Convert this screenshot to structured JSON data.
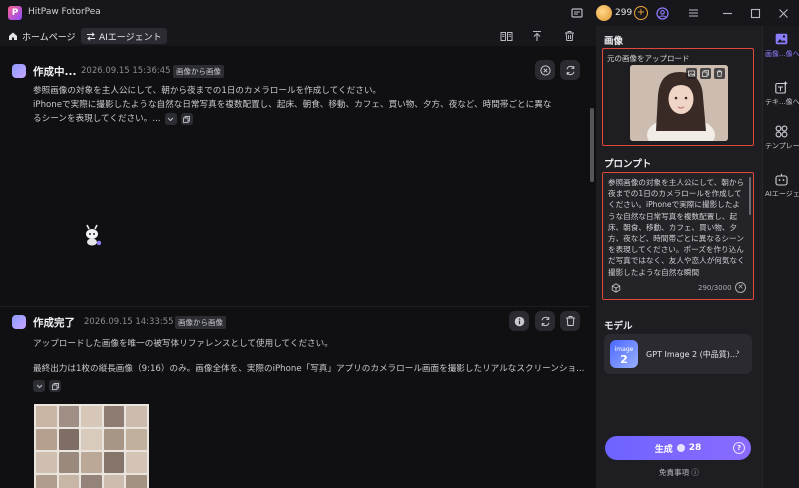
{
  "app": {
    "title": "HitPaw FotorPea",
    "logo_letter": "P"
  },
  "titlebar": {
    "credits": "299",
    "plus_label": "+"
  },
  "nav": {
    "home_label": "ホームページ",
    "agent_label": "AIエージェント"
  },
  "tasks": [
    {
      "status": "作成中...",
      "time": "2026.09.15 15:36:45",
      "tag": "画像から画像",
      "lines": [
        "参照画像の対象を主人公にして、朝から夜までの1日のカメラロールを作成してください。",
        "iPhoneで実際に撮影したような自然な日常写真を複数配置し、起床、朝食、移動、カフェ、買い物、夕方、夜など、時間帯ごとに異な",
        "るシーンを表現してください。..."
      ]
    },
    {
      "status": "作成完了",
      "time": "2026.09.15 14:33:55",
      "tag": "画像から画像",
      "lines": [
        "アップロードした画像を唯一の被写体リファレンスとして使用してください。",
        "",
        "最終出力は1枚の縦長画像（9:16）のみ。画像全体を、実際のiPhone「写真」アプリのカメラロール画面を撮影したリアルなスクリーンショ..."
      ]
    }
  ],
  "side": {
    "image_section": "画像",
    "upload_caption": "元の画像をアップロード",
    "prompt_section": "プロンプト",
    "prompt_text": "参照画像の対象を主人公にして、朝から夜までの1日のカメラロールを作成してください。iPhoneで実際に撮影したような自然な日常写真を複数配置し、起床、朝食、移動、カフェ、買い物、夕方、夜など、時間帯ごとに異なるシーンを表現してください。ポーズを作り込んだ写真ではなく、友人や恋人が何気なく撮影したような自然な瞬間",
    "prompt_count": "290/3000",
    "model_section": "モデル",
    "model_logo_top": "image",
    "model_logo_num": "2",
    "model_name": "GPT Image 2 (中品質)...",
    "generate_label": "生成",
    "generate_cost": "28",
    "disclaimer": "免責事項 ⓘ"
  },
  "rail": [
    {
      "label": "画像...像へ",
      "icon": "image-icon",
      "active": true
    },
    {
      "label": "テキ...像へ",
      "icon": "text-to-image-icon",
      "active": false
    },
    {
      "label": "テンプレート",
      "icon": "template-icon",
      "active": false
    },
    {
      "label": "AIエージェント",
      "icon": "ai-agent-icon",
      "active": false
    }
  ],
  "colors": {
    "accent": "#7b68ff",
    "highlight_border": "#e0483e",
    "coin": "#f0a83a"
  }
}
